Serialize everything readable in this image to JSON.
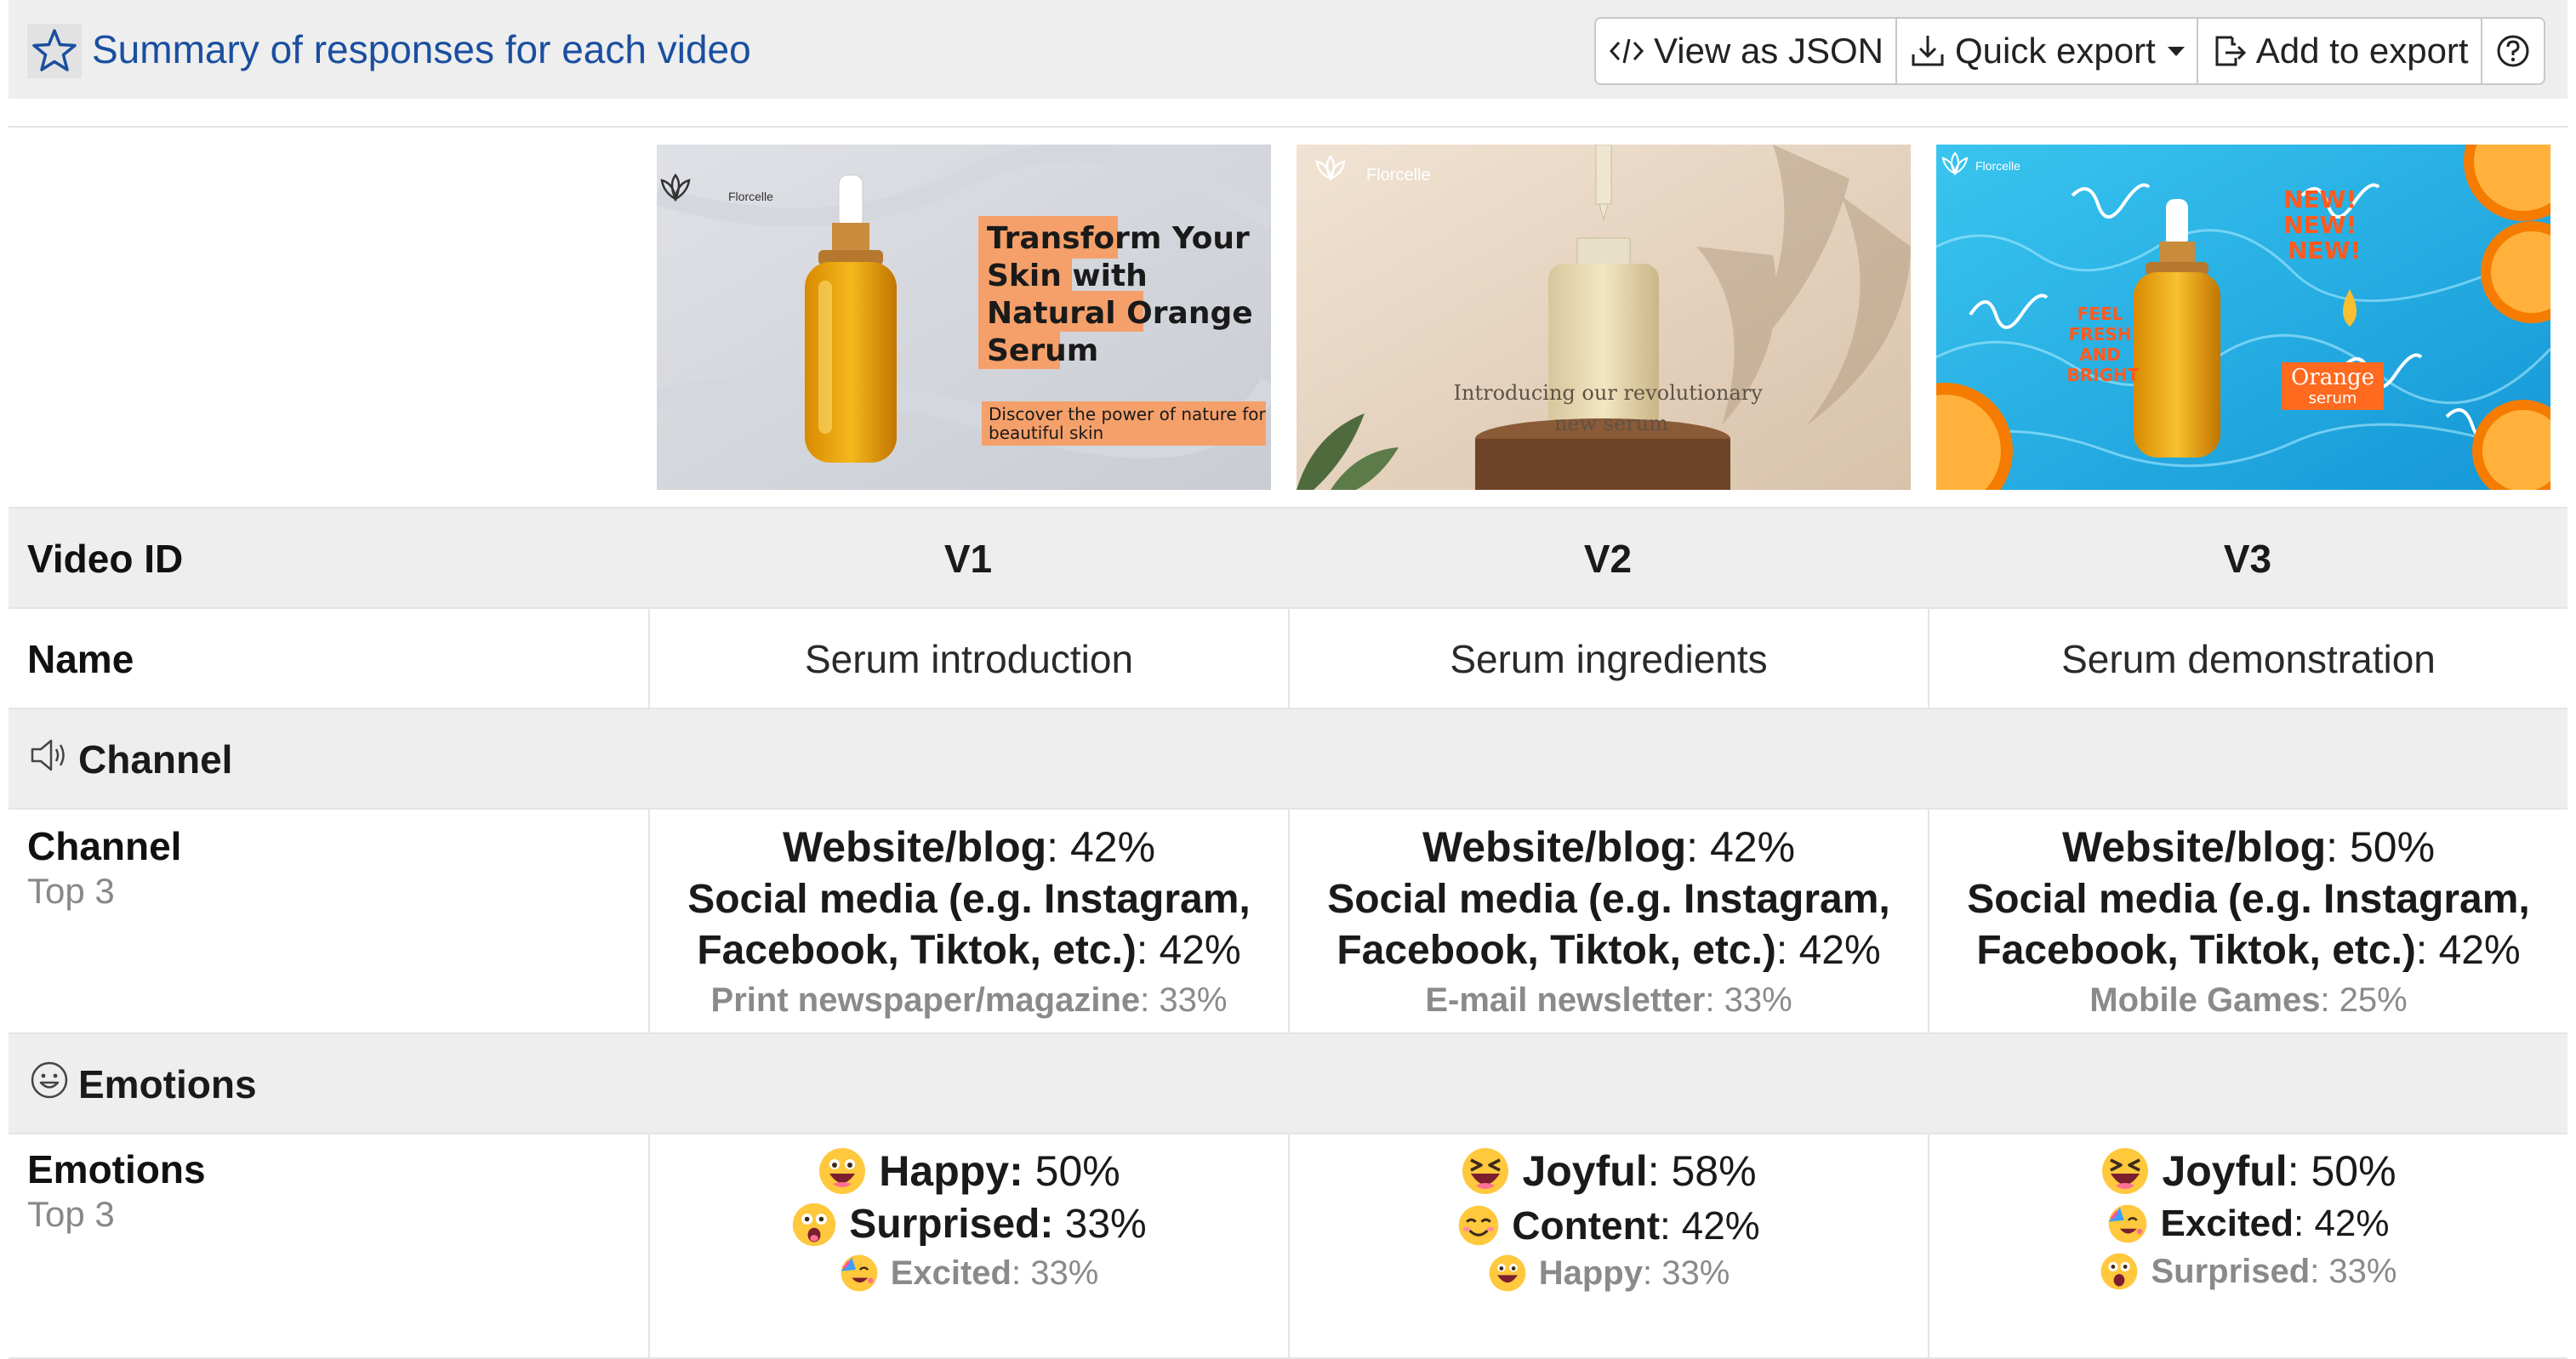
{
  "header": {
    "title": "Summary of responses for each video",
    "toolbar": {
      "view_json": "View as JSON",
      "quick_export": "Quick export",
      "add_to_export": "Add to export"
    }
  },
  "thumbnails": [
    {
      "brand": "Florcelle",
      "headline": [
        "Transform Your",
        "Skin with",
        "Natural Orange",
        "Serum"
      ],
      "tagline": [
        "Discover the power of nature for",
        "beautiful skin"
      ]
    },
    {
      "brand": "Florcelle",
      "caption": [
        "Introducing our revolutionary",
        "new serum"
      ]
    },
    {
      "brand": "Florcelle",
      "new": [
        "NEW!",
        "NEW!",
        "NEW!"
      ],
      "feel": [
        "FEEL",
        "FRESH",
        "AND",
        "BRIGHT"
      ],
      "orange": [
        "Orange",
        "serum"
      ]
    }
  ],
  "rows": {
    "video_id": {
      "label": "Video ID",
      "values": [
        "V1",
        "V2",
        "V3"
      ]
    },
    "name": {
      "label": "Name",
      "values": [
        "Serum introduction",
        "Serum ingredients",
        "Serum demonstration"
      ]
    }
  },
  "sections": {
    "channel": "Channel",
    "emotions": "Emotions"
  },
  "channel": {
    "label": "Channel",
    "sublabel": "Top 3",
    "columns": [
      [
        {
          "name": "Website/blog",
          "value": ": 42%"
        },
        {
          "name": "Social media (e.g. Instagram,",
          "name2": "Facebook, Tiktok, etc.)",
          "value": ": 42%"
        },
        {
          "name": "Print newspaper/magazine",
          "value": ": 33%"
        }
      ],
      [
        {
          "name": "Website/blog",
          "value": ": 42%"
        },
        {
          "name": "Social media (e.g. Instagram,",
          "name2": "Facebook, Tiktok, etc.)",
          "value": ": 42%"
        },
        {
          "name": "E-mail newsletter",
          "value": ": 33%"
        }
      ],
      [
        {
          "name": "Website/blog",
          "value": ": 50%"
        },
        {
          "name": "Social media (e.g. Instagram,",
          "name2": "Facebook, Tiktok, etc.)",
          "value": ": 42%"
        },
        {
          "name": "Mobile Games",
          "value": ": 25%"
        }
      ]
    ]
  },
  "emotions": {
    "label": "Emotions",
    "sublabel": "Top 3",
    "columns": [
      [
        {
          "name": "Happy:",
          "value": " 50%",
          "icon": "happy-emoji-icon"
        },
        {
          "name": "Surprised:",
          "value": " 33%",
          "icon": "surprised-emoji-icon"
        },
        {
          "name": "Excited",
          "value": ": 33%",
          "icon": "excited-emoji-icon"
        }
      ],
      [
        {
          "name": "Joyful",
          "value": ": 58%",
          "icon": "joyful-emoji-icon"
        },
        {
          "name": "Content",
          "value": ": 42%",
          "icon": "content-emoji-icon"
        },
        {
          "name": "Happy",
          "value": ": 33%",
          "icon": "happy-emoji-icon"
        }
      ],
      [
        {
          "name": "Joyful",
          "value": ": 50%",
          "icon": "joyful-emoji-icon"
        },
        {
          "name": "Excited",
          "value": ": 42%",
          "icon": "excited-emoji-icon"
        },
        {
          "name": "Surprised",
          "value": ": 33%",
          "icon": "surprised-emoji-icon"
        }
      ]
    ]
  },
  "colors": {
    "title_blue": "#1a4fa0",
    "row_gray": "#eeeeee",
    "accent_orange": "#f5a06a",
    "muted_text": "#8a8a8a"
  }
}
